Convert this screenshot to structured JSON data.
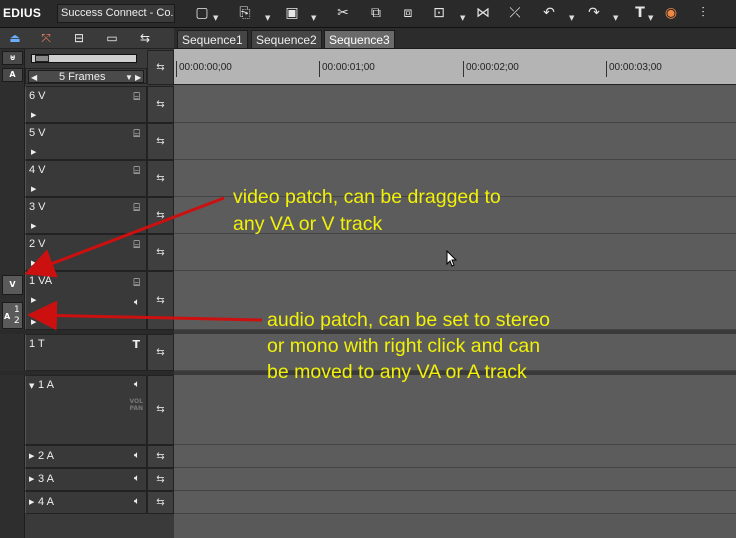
{
  "app": {
    "name": "EDIUS",
    "project": "Success Connect - Co..."
  },
  "toolbar": {
    "icons": [
      "new-icon",
      "open-icon",
      "save-icon",
      "cut-icon",
      "copy-icon",
      "paste-icon",
      "replace-icon",
      "ripple-delete-icon",
      "delete-icon",
      "undo-icon",
      "redo-icon",
      "title-icon",
      "color-icon",
      "mixer-icon"
    ]
  },
  "sequences": {
    "tabs": [
      "Sequence1",
      "Sequence2",
      "Sequence3"
    ],
    "active": "Sequence3"
  },
  "timeline": {
    "scale_label": "5 Frames",
    "timecodes": [
      "00:00:00;00",
      "00:00:01;00",
      "00:00:02;00",
      "00:00:03;00"
    ]
  },
  "tracks": {
    "v6": "6 V",
    "v5": "5 V",
    "v4": "4 V",
    "v3": "3 V",
    "v2": "2 V",
    "va1": "1 VA",
    "t1": "1 T",
    "a1": "1 A",
    "a2": "2 A",
    "a3": "3 A",
    "a4": "4 A",
    "vol_pan": "VOL\nPAN"
  },
  "patch": {
    "video": "V",
    "audio_a": "A",
    "audio_1": "1",
    "audio_2": "2"
  },
  "annotations": {
    "video_line1": "video patch, can be dragged to",
    "video_line2": "any VA or V track",
    "audio_line1": "audio patch, can be set to stereo",
    "audio_line2": "or mono with right click and can",
    "audio_line3": "be moved to any VA or A track"
  },
  "colors": {
    "annotation_text": "#f1f10a",
    "annotation_arrow": "#cc1010",
    "ruler": "#b4b4b4"
  }
}
